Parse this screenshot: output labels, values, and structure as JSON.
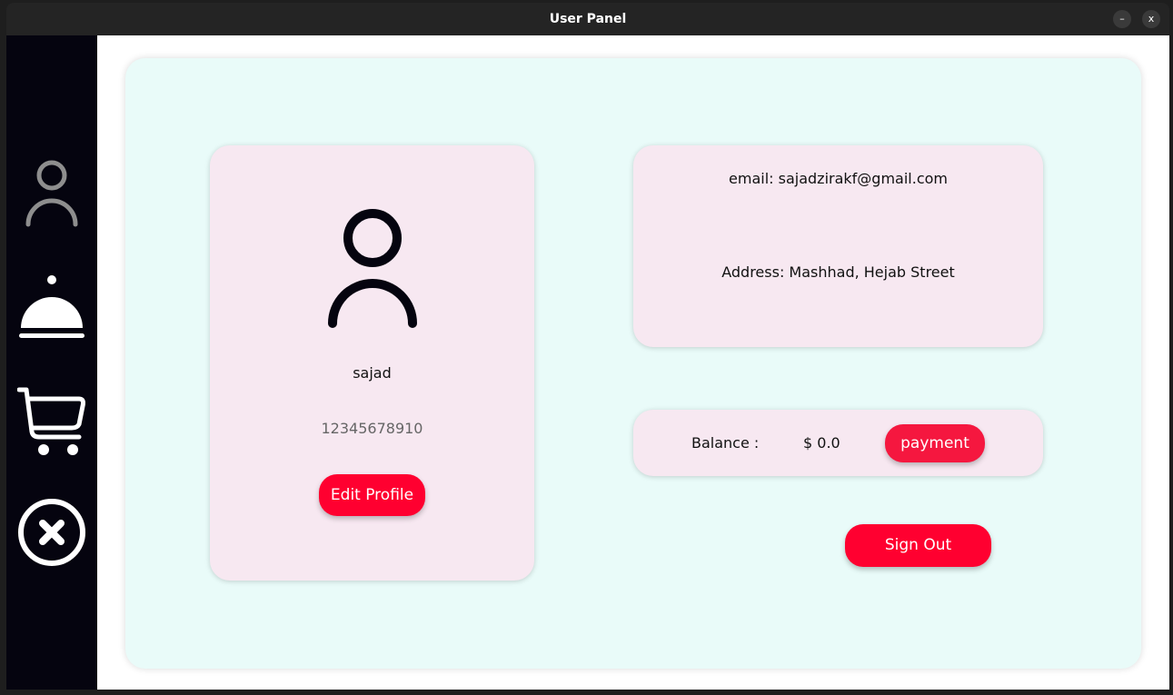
{
  "window": {
    "title": "User Panel",
    "minimize": "–",
    "close": "x"
  },
  "sidebar": {
    "items": [
      {
        "icon": "user-icon"
      },
      {
        "icon": "food-cloche-icon"
      },
      {
        "icon": "cart-icon"
      },
      {
        "icon": "close-circle-icon"
      }
    ]
  },
  "profile": {
    "name": "sajad",
    "phone": "12345678910",
    "edit_label": "Edit Profile"
  },
  "info": {
    "email": "email: sajadzirakf@gmail.com",
    "address": "Address: Mashhad, Hejab Street"
  },
  "balance": {
    "label": "Balance :",
    "value": "$ 0.0",
    "payment_label": "payment"
  },
  "signout_label": "Sign Out",
  "colors": {
    "accent": "#ff0030",
    "card": "#f7e8f1",
    "panel": "#e9fbf9",
    "sidebar": "#05040f"
  }
}
